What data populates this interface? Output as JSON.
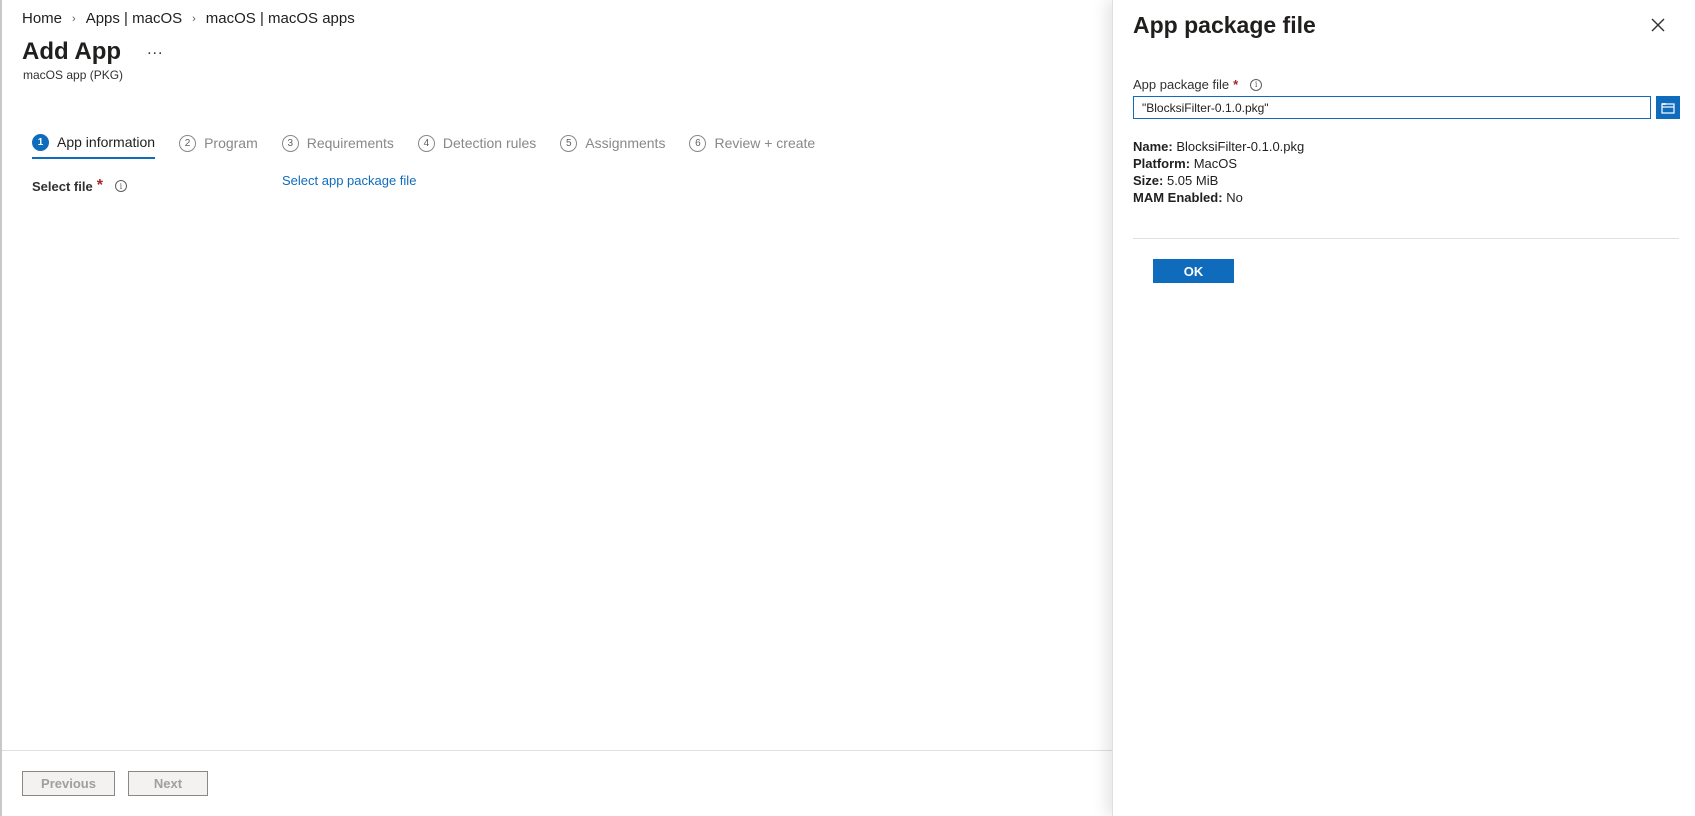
{
  "breadcrumb": [
    "Home",
    "Apps | macOS",
    "macOS | macOS apps"
  ],
  "header": {
    "title": "Add App",
    "more": "...",
    "subtitle": "macOS app (PKG)"
  },
  "steps": [
    {
      "num": "1",
      "label": "App information",
      "active": true
    },
    {
      "num": "2",
      "label": "Program",
      "active": false
    },
    {
      "num": "3",
      "label": "Requirements",
      "active": false
    },
    {
      "num": "4",
      "label": "Detection rules",
      "active": false
    },
    {
      "num": "5",
      "label": "Assignments",
      "active": false
    },
    {
      "num": "6",
      "label": "Review + create",
      "active": false
    }
  ],
  "form": {
    "select_file_label": "Select file",
    "required_mark": "*",
    "select_link": "Select app package file"
  },
  "footer": {
    "previous": "Previous",
    "next": "Next"
  },
  "panel": {
    "title": "App package file",
    "field_label": "App package file",
    "required_mark": "*",
    "file_value": "\"BlocksiFilter-0.1.0.pkg\"",
    "details": [
      {
        "key": "Name:",
        "value": "BlocksiFilter-0.1.0.pkg"
      },
      {
        "key": "Platform:",
        "value": "MacOS"
      },
      {
        "key": "Size:",
        "value": "5.05 MiB"
      },
      {
        "key": "MAM Enabled:",
        "value": "No"
      }
    ],
    "ok": "OK"
  },
  "colors": {
    "accent": "#0f6cbd",
    "required": "#a4262c"
  },
  "icons": {
    "close": "close-icon",
    "info": "info-icon",
    "browse": "folder-icon",
    "more": "more-icon"
  }
}
